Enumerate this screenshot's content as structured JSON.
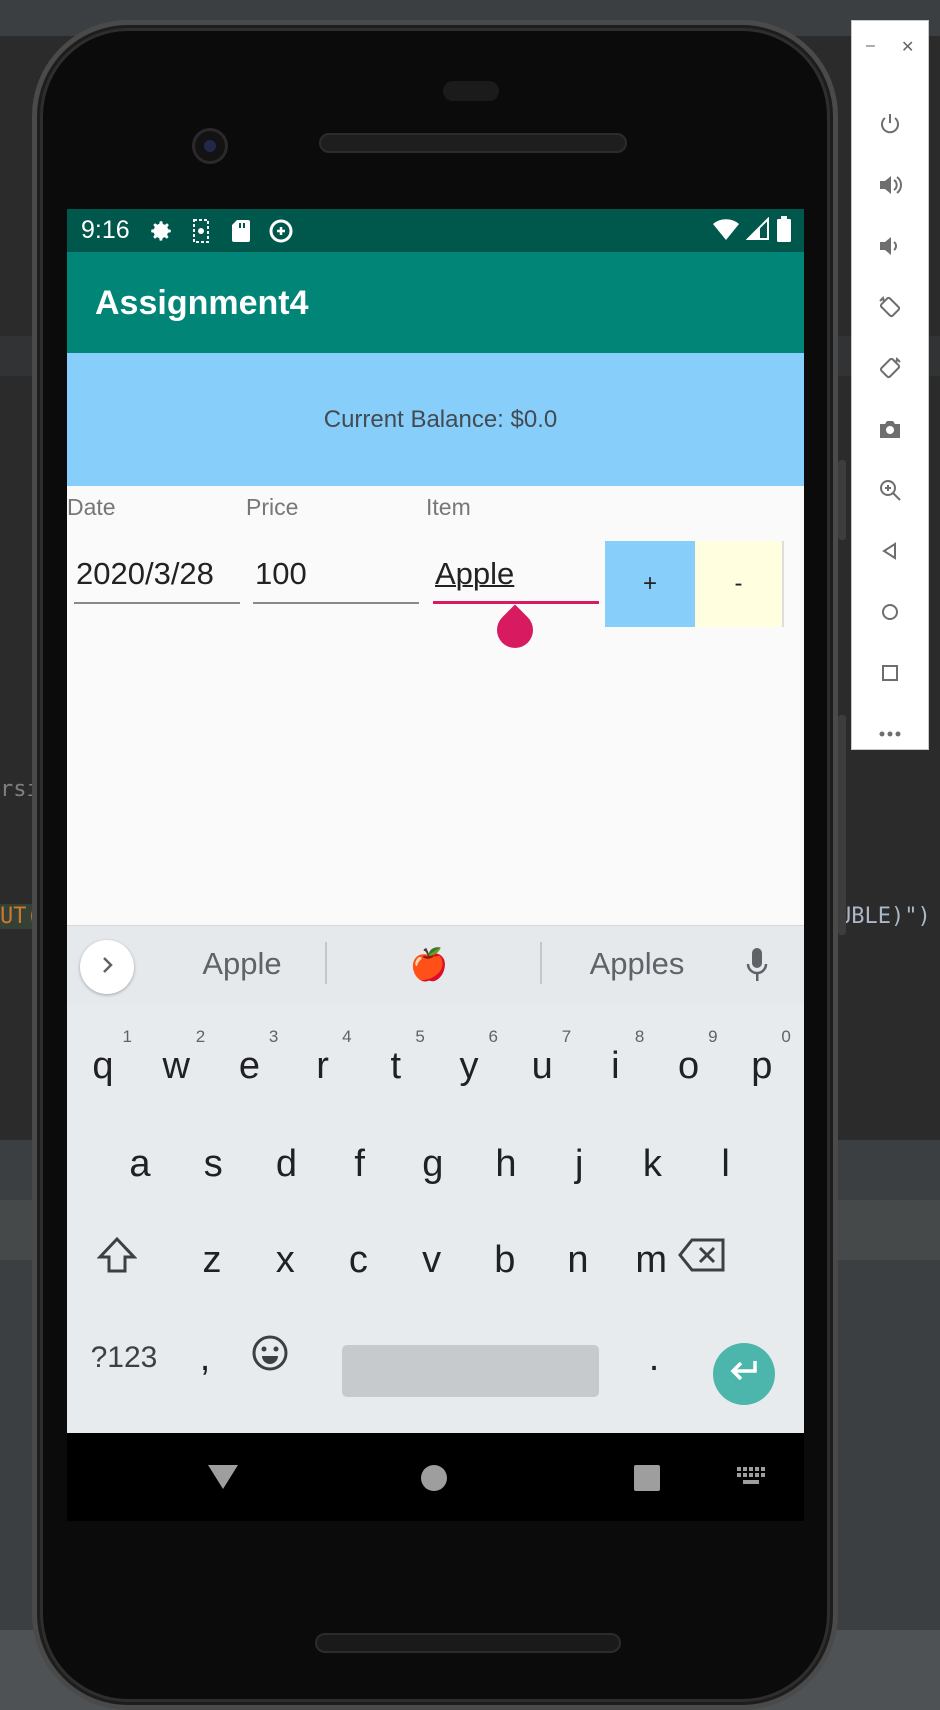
{
  "status_bar": {
    "time": "9:16",
    "left_icons": [
      "gear-icon",
      "debug-icon",
      "sd-card-icon",
      "data-saver-icon"
    ],
    "right_icons": [
      "wifi-icon",
      "signal-icon",
      "battery-icon"
    ]
  },
  "app": {
    "title": "Assignment4",
    "balance_text": "Current Balance: $0.0",
    "colors": {
      "appbar": "#008577",
      "statusbar": "#00574b",
      "accent": "#d81b60",
      "balance_bg": "#87cefa",
      "plus_bg": "#87cefa",
      "minus_bg": "#ffffe0"
    },
    "columns": {
      "date": "Date",
      "price": "Price",
      "item": "Item"
    },
    "fields": {
      "date": "2020/3/28",
      "price": "100",
      "item": "Apple"
    },
    "buttons": {
      "add": "+",
      "subtract": "-"
    }
  },
  "keyboard": {
    "suggestions": [
      "Apple",
      "🍎",
      "Apples"
    ],
    "row1": [
      {
        "k": "q",
        "h": "1"
      },
      {
        "k": "w",
        "h": "2"
      },
      {
        "k": "e",
        "h": "3"
      },
      {
        "k": "r",
        "h": "4"
      },
      {
        "k": "t",
        "h": "5"
      },
      {
        "k": "y",
        "h": "6"
      },
      {
        "k": "u",
        "h": "7"
      },
      {
        "k": "i",
        "h": "8"
      },
      {
        "k": "o",
        "h": "9"
      },
      {
        "k": "p",
        "h": "0"
      }
    ],
    "row2": [
      "a",
      "s",
      "d",
      "f",
      "g",
      "h",
      "j",
      "k",
      "l"
    ],
    "row3": [
      "z",
      "x",
      "c",
      "v",
      "b",
      "n",
      "m"
    ],
    "symbols_key": "?123",
    "comma_key": ",",
    "period_key": "."
  },
  "ide": {
    "code_left": "rsio",
    "code_left2": "UT(",
    "code_right": "UBLE)\")"
  }
}
